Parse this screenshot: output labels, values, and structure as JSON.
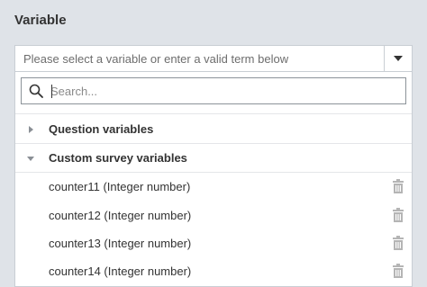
{
  "variable_section": {
    "title": "Variable",
    "select": {
      "placeholder": "Please select a variable or enter a valid term below"
    },
    "search": {
      "placeholder": "Search...",
      "value": ""
    },
    "groups": [
      {
        "label": "Question variables",
        "expanded": false
      },
      {
        "label": "Custom survey variables",
        "expanded": true
      }
    ],
    "items": [
      {
        "label": "counter11 (Integer number)",
        "icon": "trash-icon"
      },
      {
        "label": "counter12 (Integer number)",
        "icon": "trash-icon"
      },
      {
        "label": "counter13 (Integer number)",
        "icon": "trash-icon"
      },
      {
        "label": "counter14 (Integer number)",
        "icon": "trash-icon"
      }
    ]
  },
  "colors": {
    "background": "#dfe3e8",
    "border": "#c9ced4",
    "text": "#333333",
    "icon_muted": "#b5b5b5"
  }
}
